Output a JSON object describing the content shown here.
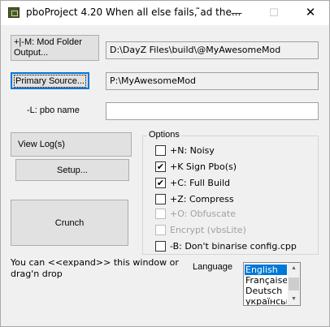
{
  "window": {
    "title": "pboProject 4.20 When all else fails, ̃ad the...",
    "min_glyph": "—",
    "max_glyph": "☐",
    "close_glyph": "✕"
  },
  "buttons": {
    "mod_folder": "+|-M: Mod Folder Output...",
    "primary_source": "Primary Source...",
    "view_log": "View Log(s)",
    "setup": "Setup...",
    "crunch": "Crunch"
  },
  "fields": {
    "output_path": "D:\\DayZ Files\\build\\@MyAwesomeMod",
    "source_path": "P:\\MyAwesomeMod",
    "pbo_name_label": "-L: pbo name",
    "pbo_name_value": ""
  },
  "options": {
    "legend": "Options",
    "items": [
      {
        "label": "+N: Noisy",
        "checked": false,
        "disabled": false
      },
      {
        "label": "+K Sign Pbo(s)",
        "checked": true,
        "disabled": false
      },
      {
        "label": "+C: Full Build",
        "checked": true,
        "disabled": false
      },
      {
        "label": "+Z: Compress",
        "checked": false,
        "disabled": false
      },
      {
        "label": "+O: Obfuscate",
        "checked": false,
        "disabled": true
      },
      {
        "label": "Encrypt (vbsLite)",
        "checked": false,
        "disabled": true
      },
      {
        "label": "-B: Don't binarise config.cpp",
        "checked": false,
        "disabled": false
      }
    ]
  },
  "hint": "You can <<expand>> this window or drag'n drop",
  "language": {
    "label": "Language",
    "options": [
      "English",
      "Française",
      "Deutsch",
      "українськ"
    ],
    "selected": "English"
  },
  "colors": {
    "selection": "#0078d7",
    "focus_border": "#0078d7",
    "window_bg": "#f0f0f0"
  }
}
